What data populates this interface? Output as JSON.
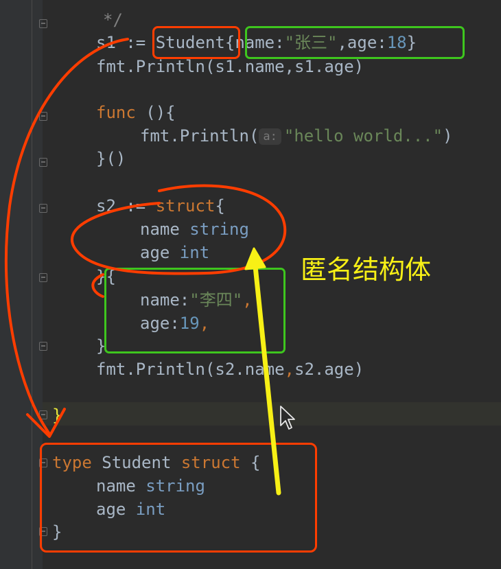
{
  "colors": {
    "background": "#2b2b2b",
    "keyword": "#cc7832",
    "string": "#6a8759",
    "number": "#6897bb",
    "identifier": "#a9b7c6",
    "annotation_red": "#ff3d00",
    "annotation_green": "#3ec61e",
    "annotation_yellow": "#f7f016"
  },
  "code": {
    "comment_end": "*/",
    "s1_prefix": "s1 := ",
    "s1_type": "Student",
    "s1_open": "{",
    "s1_name_key": "name:",
    "s1_name_val": "\"张三\"",
    "s1_age_key": ",age:",
    "s1_age_val": "18",
    "s1_close": "}",
    "println1": "fmt.Println(s1.name,s1.age)",
    "func_kw": "func",
    "func_rest": " (){",
    "println2_call": "fmt.Println(",
    "println2_hint": "a:",
    "println2_arg": "\"hello world...\"",
    "println2_close": ")",
    "func_close": "}()",
    "s2_prefix": "s2 := ",
    "s2_struct_kw": "struct",
    "s2_open": "{",
    "field_name": "name ",
    "field_name_type": "string",
    "field_age": "age ",
    "field_age_type": "int",
    "s2_mid": "}{",
    "s2_name_key": "name:",
    "s2_name_val": "\"李四\"",
    "s2_name_comma": ",",
    "s2_age_key": "age:",
    "s2_age_val": "19",
    "s2_age_comma": ",",
    "s2_close": "}",
    "println3_a": "fmt.Println(s2.name",
    "println3_comma": ",",
    "println3_b": "s2.age)",
    "main_close": "}",
    "type_kw": "type",
    "type_name": " Student ",
    "type_struct_kw": "struct",
    "type_open": " {",
    "type_field_name": "name ",
    "type_field_name_type": "string",
    "type_field_age": "age ",
    "type_field_age_type": "int",
    "type_close": "}"
  },
  "annotation_label": "匿名结构体"
}
